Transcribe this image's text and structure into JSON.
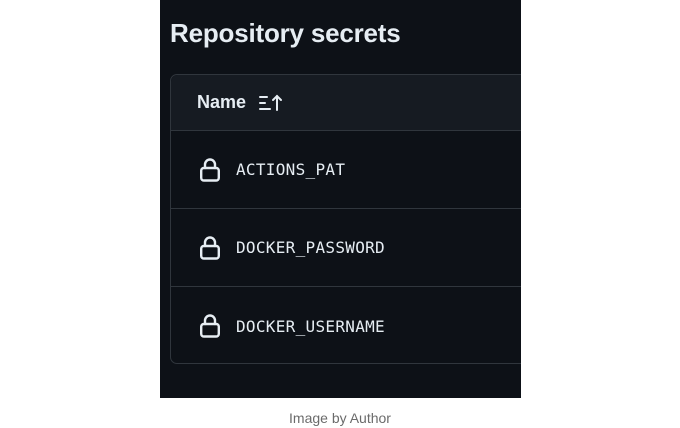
{
  "title": "Repository secrets",
  "table": {
    "column_header": "Name",
    "sort_icon": "sort-ascending-icon",
    "rows": [
      {
        "icon": "lock-icon",
        "name": "ACTIONS_PAT"
      },
      {
        "icon": "lock-icon",
        "name": "DOCKER_PASSWORD"
      },
      {
        "icon": "lock-icon",
        "name": "DOCKER_USERNAME"
      }
    ]
  },
  "caption": "Image by Author",
  "colors": {
    "background": "#0d1117",
    "header_background": "#161b22",
    "border": "#30363d",
    "text": "#e6edf3",
    "caption_text": "#6b6b6b"
  }
}
